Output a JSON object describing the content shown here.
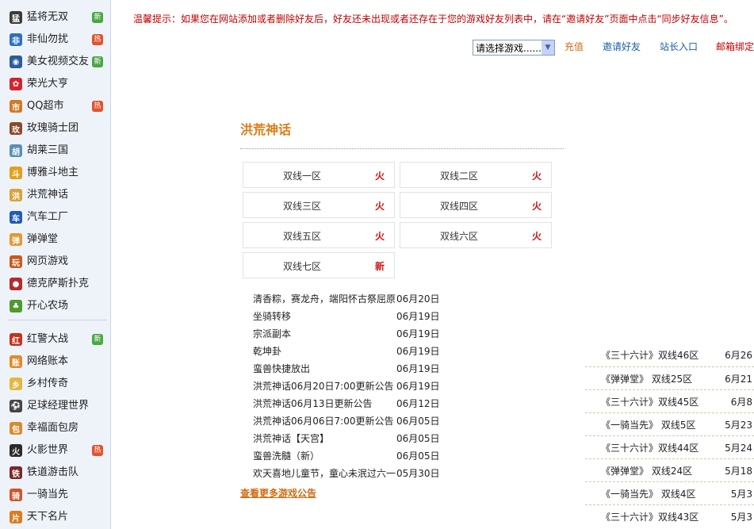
{
  "sidebar": {
    "items": [
      {
        "label": "猛将无双",
        "icon": "mengjiang-game-icon",
        "icon_char": "猛",
        "icon_color": "#3b3b3b",
        "badge": "新",
        "badge_type": "new"
      },
      {
        "label": "非仙勿扰",
        "icon": "feixian-game-icon",
        "icon_char": "非",
        "icon_color": "#2f6fc1",
        "badge": "热",
        "badge_type": "hot"
      },
      {
        "label": "美女视频交友",
        "icon": "video-chat-icon",
        "icon_char": "◉",
        "icon_color": "#2a5c9e",
        "badge": "新",
        "badge_type": "new"
      },
      {
        "label": "荣光大亨",
        "icon": "rongguang-game-icon",
        "icon_char": "✿",
        "icon_color": "#d2252f",
        "badge": "",
        "badge_type": ""
      },
      {
        "label": "QQ超市",
        "icon": "supermarket-icon",
        "icon_char": "市",
        "icon_color": "#d17a26",
        "badge": "热",
        "badge_type": "hot"
      },
      {
        "label": "玫瑰骑士团",
        "icon": "rose-knight-icon",
        "icon_char": "玫",
        "icon_color": "#8a4b2b",
        "badge": "",
        "badge_type": ""
      },
      {
        "label": "胡莱三国",
        "icon": "hulai-sanguo-icon",
        "icon_char": "胡",
        "icon_color": "#5a8fb8",
        "badge": "",
        "badge_type": ""
      },
      {
        "label": "博雅斗地主",
        "icon": "doudizhu-icon",
        "icon_char": "斗",
        "icon_color": "#e0a21c",
        "badge": "",
        "badge_type": ""
      },
      {
        "label": "洪荒神话",
        "icon": "honghuang-game-icon",
        "icon_char": "洪",
        "icon_color": "#d4a53a",
        "badge": "",
        "badge_type": ""
      },
      {
        "label": "汽车工厂",
        "icon": "car-factory-icon",
        "icon_char": "车",
        "icon_color": "#245bb5",
        "badge": "",
        "badge_type": ""
      },
      {
        "label": "弹弹堂",
        "icon": "ddtank-icon",
        "icon_char": "弹",
        "icon_color": "#e59634",
        "badge": "",
        "badge_type": ""
      },
      {
        "label": "网页游戏",
        "icon": "web-game-icon",
        "icon_char": "玩",
        "icon_color": "#c85a1c",
        "badge": "",
        "badge_type": ""
      },
      {
        "label": "德克萨斯扑克",
        "icon": "poker-icon",
        "icon_char": "●",
        "icon_color": "#b72a2a",
        "badge": "",
        "badge_type": ""
      },
      {
        "label": "开心农场",
        "icon": "happy-farm-icon",
        "icon_char": "♣",
        "icon_color": "#4e9b2c",
        "badge": "",
        "badge_type": ""
      }
    ],
    "items2": [
      {
        "label": "红警大战",
        "icon": "red-alert-icon",
        "icon_char": "红",
        "icon_color": "#c4321f",
        "badge": "新",
        "badge_type": "new"
      },
      {
        "label": "网络账本",
        "icon": "ledger-icon",
        "icon_char": "账",
        "icon_color": "#e18a2a",
        "badge": "",
        "badge_type": ""
      },
      {
        "label": "乡村传奇",
        "icon": "village-legend-icon",
        "icon_char": "乡",
        "icon_color": "#e4b73c",
        "badge": "",
        "badge_type": ""
      },
      {
        "label": "足球经理世界",
        "icon": "football-icon",
        "icon_char": "⚽",
        "icon_color": "#444444",
        "badge": "",
        "badge_type": ""
      },
      {
        "label": "幸福面包房",
        "icon": "bakery-icon",
        "icon_char": "包",
        "icon_color": "#d88a2e",
        "badge": "",
        "badge_type": ""
      },
      {
        "label": "火影世界",
        "icon": "naruto-icon",
        "icon_char": "火",
        "icon_color": "#2b2b2b",
        "badge": "热",
        "badge_type": "hot"
      },
      {
        "label": "铁道游击队",
        "icon": "railway-icon",
        "icon_char": "铁",
        "icon_color": "#7a2a2a",
        "badge": "",
        "badge_type": ""
      },
      {
        "label": "一骑当先",
        "icon": "yiqi-icon",
        "icon_char": "骑",
        "icon_color": "#d2542c",
        "badge": "",
        "badge_type": ""
      },
      {
        "label": "天下名片",
        "icon": "namecard-icon",
        "icon_char": "片",
        "icon_color": "#e07a1c",
        "badge": "",
        "badge_type": ""
      }
    ]
  },
  "notice": {
    "text": "温馨提示：如果您在网站添加或者删除好友后，好友还未出现或者还存在于您的游戏好友列表中，请在“邀请好友”页面中点击“同步好友信息”。",
    "color": "#c00000"
  },
  "toolbar": {
    "select_value": "请选择游戏......",
    "recharge": "充值",
    "invite": "邀请好友",
    "webmaster": "站长入口",
    "mail_bind": "邮箱绑定"
  },
  "main": {
    "title": "洪荒神话",
    "servers": [
      {
        "name": "双线一区",
        "tag": "火"
      },
      {
        "name": "双线二区",
        "tag": "火"
      },
      {
        "name": "双线三区",
        "tag": "火"
      },
      {
        "name": "双线四区",
        "tag": "火"
      },
      {
        "name": "双线五区",
        "tag": "火"
      },
      {
        "name": "双线六区",
        "tag": "火"
      },
      {
        "name": "双线七区",
        "tag": "新"
      }
    ],
    "news": [
      {
        "title": "清香粽，赛龙舟，端阳怀古祭屈原",
        "date": "06月20日"
      },
      {
        "title": "坐骑转移",
        "date": "06月19日"
      },
      {
        "title": "宗派副本",
        "date": "06月19日"
      },
      {
        "title": "乾坤卦",
        "date": "06月19日"
      },
      {
        "title": "蛮兽快捷放出",
        "date": "06月19日"
      },
      {
        "title": "洪荒神话06月20日7:00更新公告",
        "date": "06月19日"
      },
      {
        "title": "洪荒神话06月13日更新公告",
        "date": "06月12日"
      },
      {
        "title": "洪荒神话06月06日7:00更新公告",
        "date": "06月05日"
      },
      {
        "title": "洪荒神话【天宫】",
        "date": "06月05日"
      },
      {
        "title": "蛮兽洗髓（新）",
        "date": "06月05日"
      },
      {
        "title": "欢天喜地儿童节，童心未泯过六一",
        "date": "05月30日"
      }
    ],
    "more": "查看更多游戏公告"
  },
  "right_list": [
    {
      "name": "《三十六计》双线46区",
      "date": "6月26"
    },
    {
      "name": "《弹弹堂》 双线25区",
      "date": "6月21"
    },
    {
      "name": "《三十六计》双线45区",
      "date": "6月8"
    },
    {
      "name": "《一骑当先》 双线5区",
      "date": "5月23"
    },
    {
      "name": "《三十六计》双线44区",
      "date": "5月24"
    },
    {
      "name": "《弹弹堂》 双线24区",
      "date": "5月18"
    },
    {
      "name": "《一骑当先》 双线4区",
      "date": "5月3"
    },
    {
      "name": "《三十六计》双线43区",
      "date": "5月3"
    }
  ],
  "colors": {
    "accent_orange": "#e07a14",
    "hot_red": "#d21414",
    "link_blue": "#1a5fa8",
    "link_red": "#c00000"
  }
}
